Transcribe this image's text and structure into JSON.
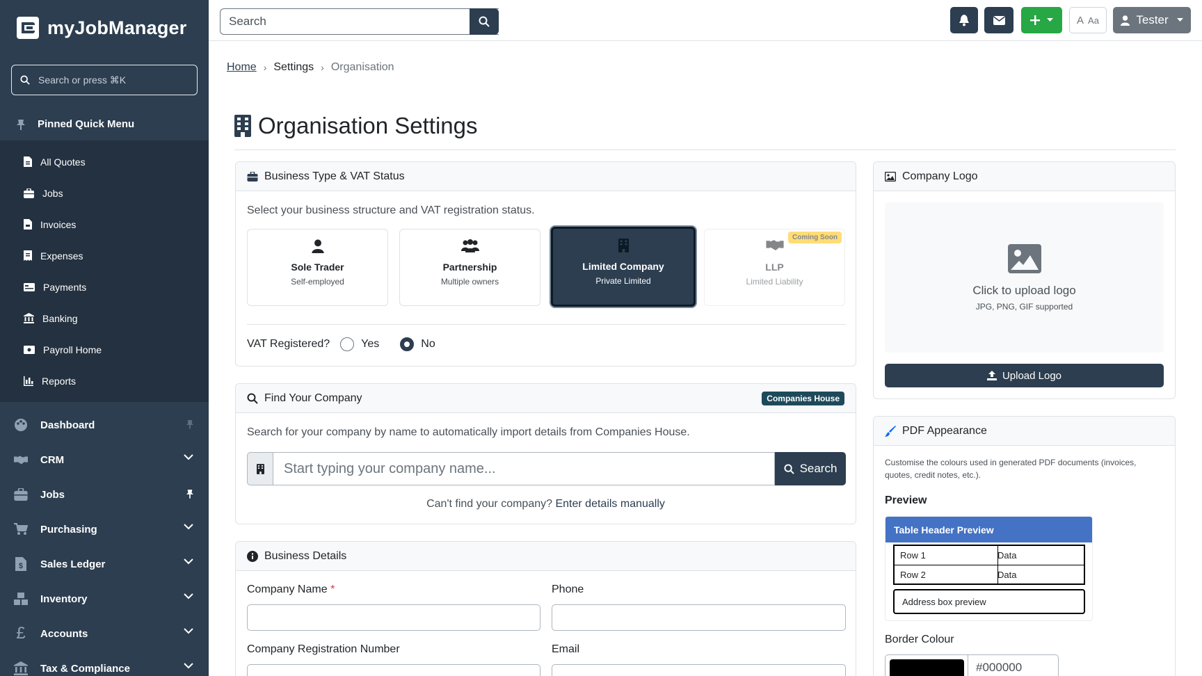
{
  "app": {
    "name": "myJobManager"
  },
  "sidebar": {
    "search_placeholder": "Search or press ⌘K",
    "pinned_title": "Pinned Quick Menu",
    "pinned_items": [
      {
        "label": "All Quotes",
        "icon": "file-icon"
      },
      {
        "label": "Jobs",
        "icon": "briefcase-icon"
      },
      {
        "label": "Invoices",
        "icon": "file-invoice-icon"
      },
      {
        "label": "Expenses",
        "icon": "receipt-icon"
      },
      {
        "label": "Payments",
        "icon": "money-check-icon"
      },
      {
        "label": "Banking",
        "icon": "bank-icon"
      },
      {
        "label": "Payroll Home",
        "icon": "money-bill-icon"
      },
      {
        "label": "Reports",
        "icon": "chart-icon"
      }
    ],
    "nav_items": [
      {
        "label": "Dashboard",
        "icon": "palette-icon",
        "right": "pin"
      },
      {
        "label": "CRM",
        "icon": "handshake-icon",
        "right": "chevron"
      },
      {
        "label": "Jobs",
        "icon": "briefcase-icon",
        "right": "pin"
      },
      {
        "label": "Purchasing",
        "icon": "cart-icon",
        "right": "chevron"
      },
      {
        "label": "Sales Ledger",
        "icon": "file-invoice-dollar-icon",
        "right": "chevron"
      },
      {
        "label": "Inventory",
        "icon": "boxes-icon",
        "right": "chevron"
      },
      {
        "label": "Accounts",
        "icon": "pound-icon",
        "right": "chevron"
      },
      {
        "label": "Tax & Compliance",
        "icon": "landmark-icon",
        "right": "chevron"
      }
    ]
  },
  "topbar": {
    "search_placeholder": "Search",
    "user_label": "Tester",
    "font_toggle_label": "A",
    "font_toggle_small": "Aa"
  },
  "breadcrumb": {
    "home": "Home",
    "settings": "Settings",
    "current": "Organisation"
  },
  "page": {
    "title": "Organisation Settings"
  },
  "business_type": {
    "title": "Business Type & VAT Status",
    "description": "Select your business structure and VAT registration status.",
    "options": [
      {
        "title": "Sole Trader",
        "subtitle": "Self-employed",
        "state": "normal"
      },
      {
        "title": "Partnership",
        "subtitle": "Multiple owners",
        "state": "normal"
      },
      {
        "title": "Limited Company",
        "subtitle": "Private Limited",
        "state": "selected"
      },
      {
        "title": "LLP",
        "subtitle": "Limited Liability",
        "state": "disabled",
        "badge": "Coming Soon"
      }
    ],
    "vat_label": "VAT Registered?",
    "vat_yes": "Yes",
    "vat_no": "No",
    "vat_selected": "No"
  },
  "find_company": {
    "title": "Find Your Company",
    "badge": "Companies House",
    "description": "Search for your company by name to automatically import details from Companies House.",
    "input_placeholder": "Start typing your company name...",
    "search_button": "Search",
    "manual_prefix": "Can't find your company?",
    "manual_link": "Enter details manually"
  },
  "business_details": {
    "title": "Business Details",
    "company_name_label": "Company Name",
    "required_mark": "*",
    "phone_label": "Phone",
    "reg_number_label": "Company Registration Number",
    "email_label": "Email"
  },
  "company_logo": {
    "title": "Company Logo",
    "upload_text": "Click to upload logo",
    "formats": "JPG, PNG, GIF supported",
    "upload_button": "Upload Logo"
  },
  "pdf_appearance": {
    "title": "PDF Appearance",
    "description": "Customise the colours used in generated PDF documents (invoices, quotes, credit notes, etc.).",
    "preview_title": "Preview",
    "table_header": "Table Header Preview",
    "rows": [
      {
        "c1": "Row 1",
        "c2": "Data"
      },
      {
        "c1": "Row 2",
        "c2": "Data"
      }
    ],
    "address_box": "Address box preview",
    "border_colour_label": "Border Colour",
    "border_colour_value": "#000000",
    "header_colour": "#4472c4"
  },
  "colors": {
    "sidebar": "#2c3e50",
    "success": "#28a745",
    "warning": "#ffc107"
  }
}
